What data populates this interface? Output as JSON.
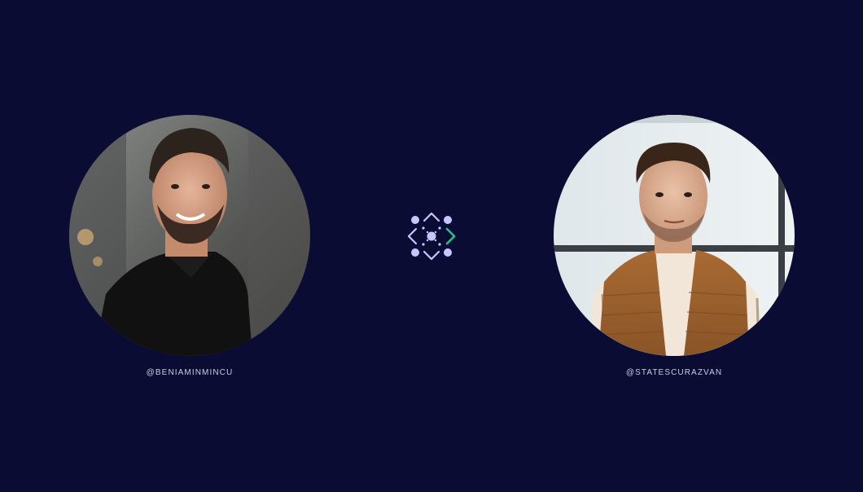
{
  "colors": {
    "background": "#0b0c33",
    "handle_text": "#c9cde6",
    "logo_primary": "#c8c6ff",
    "logo_accent": "#24c08c"
  },
  "profiles": [
    {
      "handle": "@BENIAMINMINCU",
      "avatar_icon": "person-photo-dark-polo"
    },
    {
      "handle": "@STATESCURAZVAN",
      "avatar_icon": "person-photo-brown-vest"
    }
  ],
  "logo": {
    "icon": "connected-nodes-logo"
  }
}
